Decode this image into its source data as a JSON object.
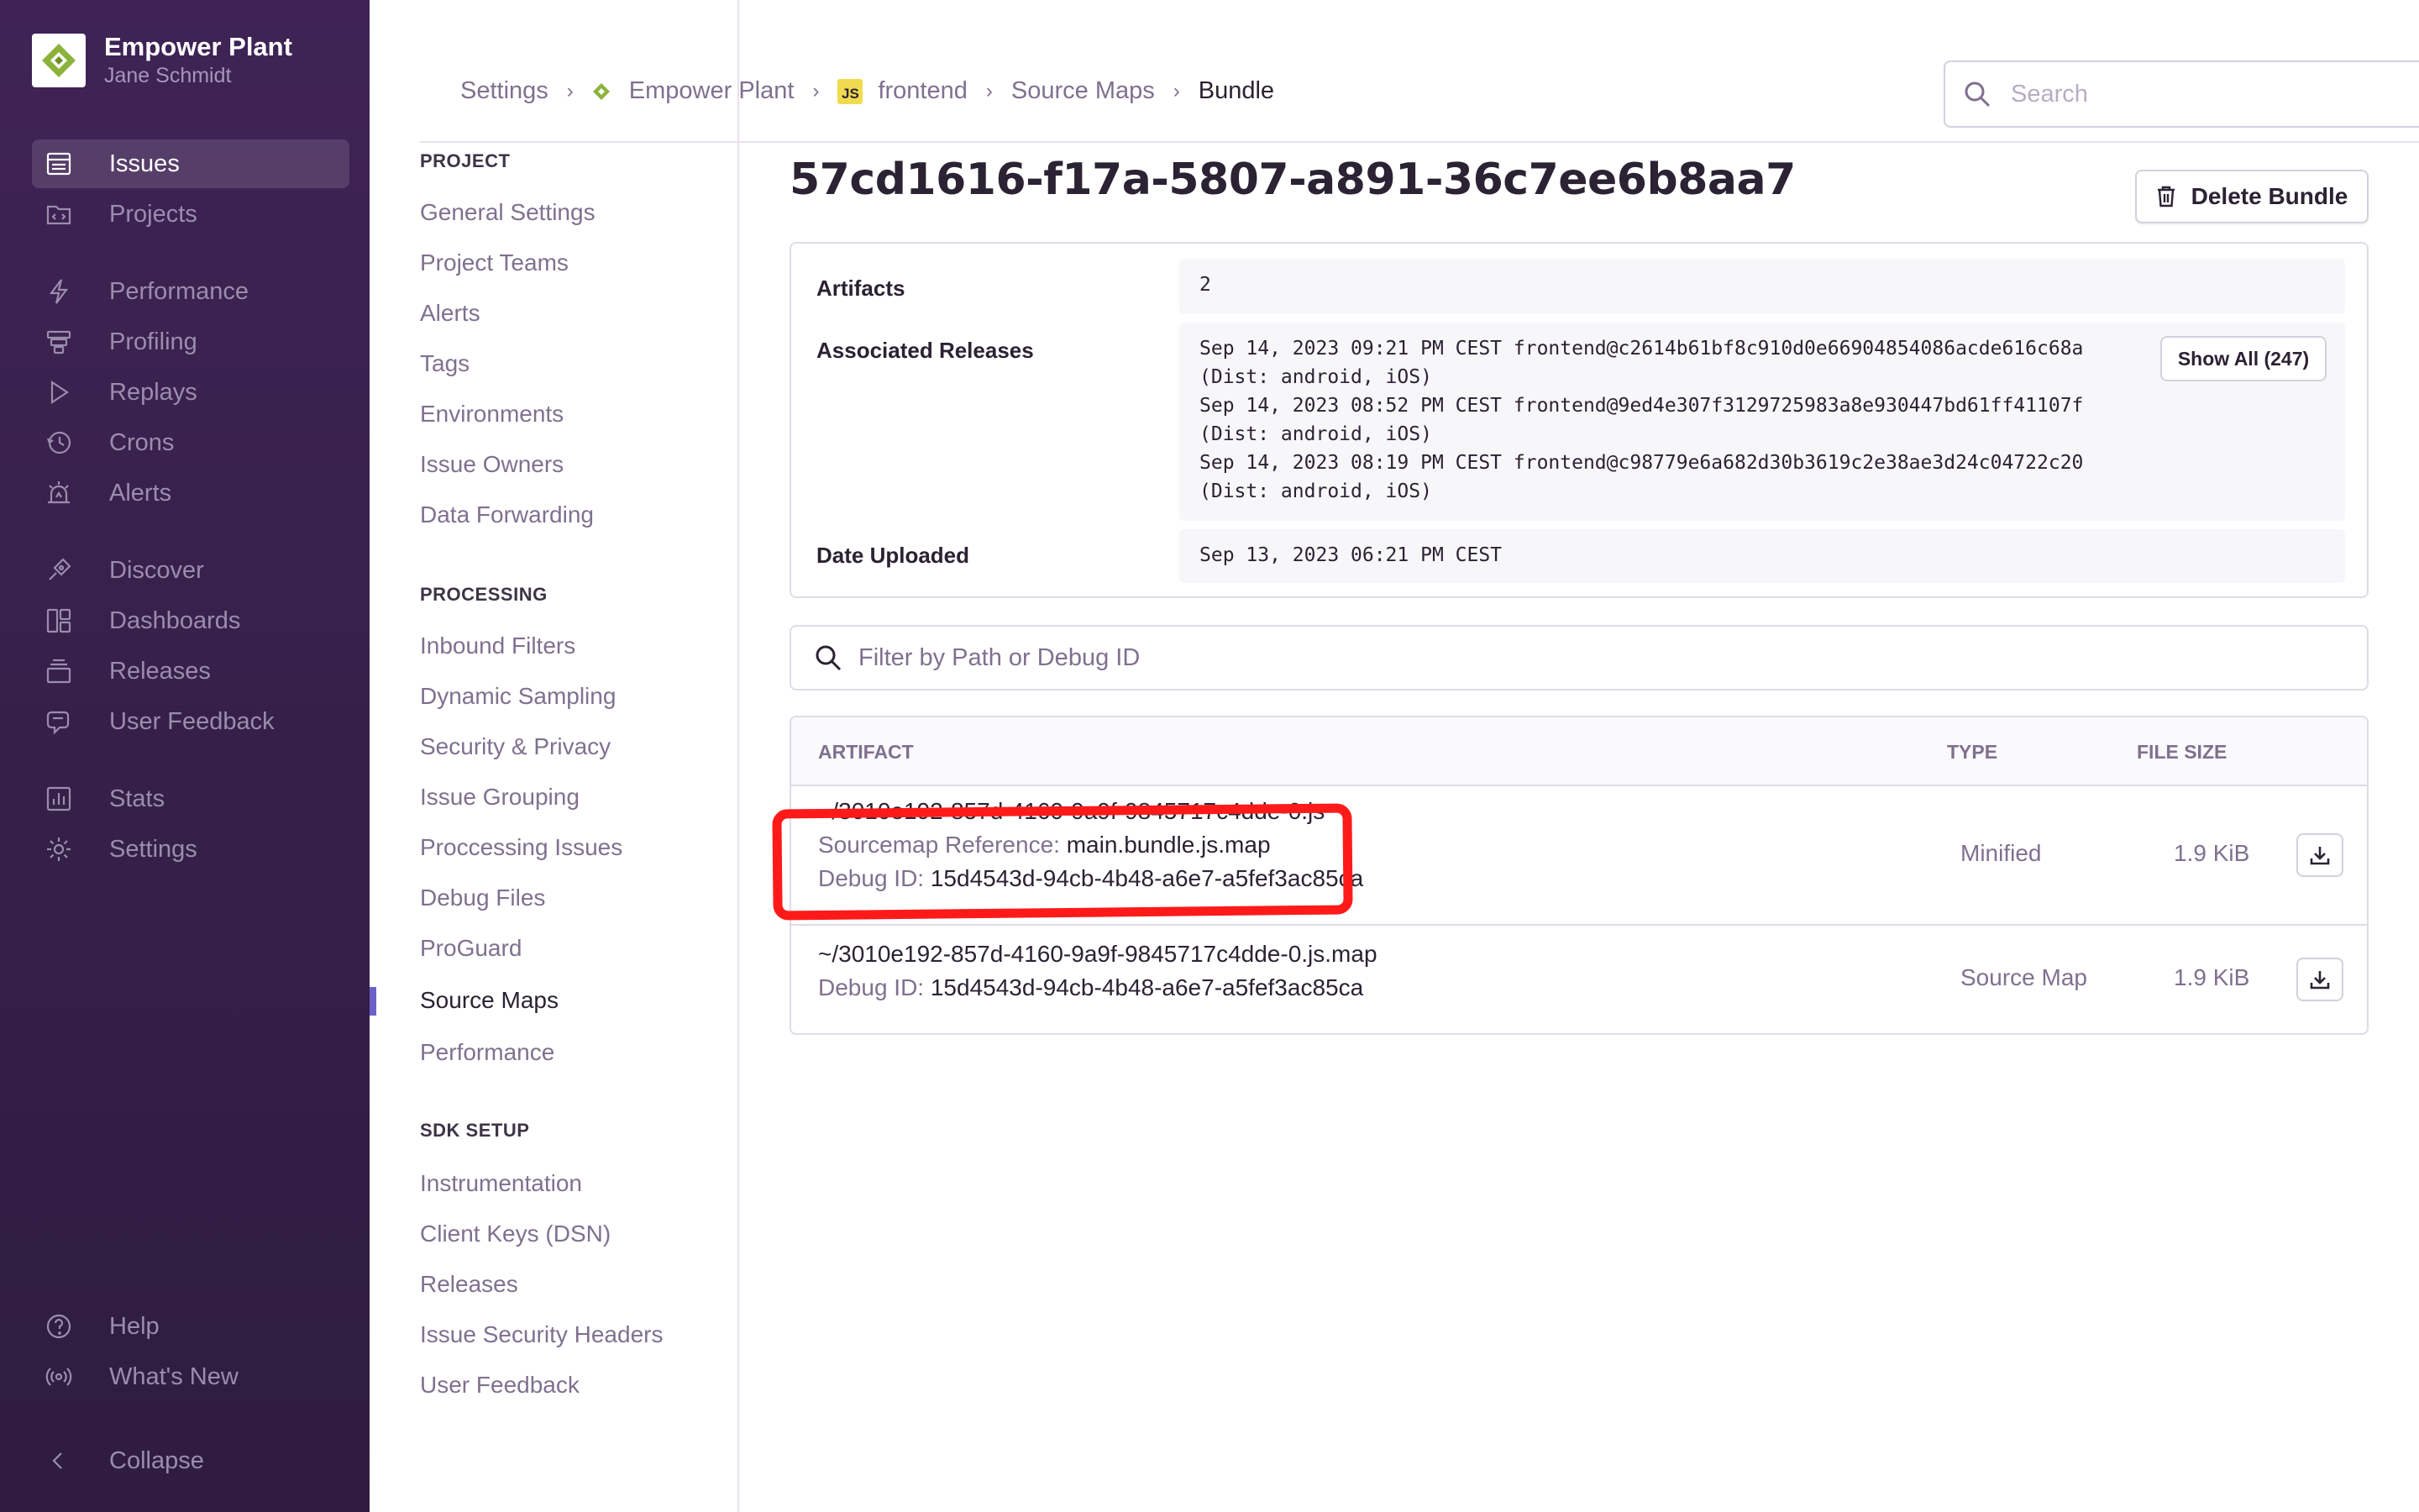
{
  "org": {
    "name": "Empower Plant",
    "user": "Jane Schmidt"
  },
  "sidebar": {
    "items": [
      {
        "label": "Issues",
        "icon": "issues-icon",
        "active": true
      },
      {
        "label": "Projects",
        "icon": "projects-icon"
      },
      {
        "label": "Performance",
        "icon": "performance-icon"
      },
      {
        "label": "Profiling",
        "icon": "profiling-icon"
      },
      {
        "label": "Replays",
        "icon": "replays-icon"
      },
      {
        "label": "Crons",
        "icon": "crons-icon"
      },
      {
        "label": "Alerts",
        "icon": "alerts-icon"
      },
      {
        "label": "Discover",
        "icon": "discover-icon"
      },
      {
        "label": "Dashboards",
        "icon": "dashboards-icon"
      },
      {
        "label": "Releases",
        "icon": "releases-icon"
      },
      {
        "label": "User Feedback",
        "icon": "user-feedback-icon"
      },
      {
        "label": "Stats",
        "icon": "stats-icon"
      },
      {
        "label": "Settings",
        "icon": "settings-icon"
      }
    ],
    "footer": [
      {
        "label": "Help",
        "icon": "help-icon"
      },
      {
        "label": "What's New",
        "icon": "broadcast-icon"
      },
      {
        "label": "Collapse",
        "icon": "chevron-left-icon"
      }
    ]
  },
  "breadcrumb": [
    "Settings",
    "Empower Plant",
    "frontend",
    "Source Maps",
    "Bundle"
  ],
  "js_badge": "JS",
  "search": {
    "placeholder": "Search"
  },
  "settings_nav": {
    "project_title": "PROJECT",
    "project": [
      "General Settings",
      "Project Teams",
      "Alerts",
      "Tags",
      "Environments",
      "Issue Owners",
      "Data Forwarding"
    ],
    "processing_title": "PROCESSING",
    "processing": [
      "Inbound Filters",
      "Dynamic Sampling",
      "Security & Privacy",
      "Issue Grouping",
      "Proccessing Issues",
      "Debug Files",
      "ProGuard",
      "Source Maps",
      "Performance"
    ],
    "sdk_title": "SDK SETUP",
    "sdk": [
      "Instrumentation",
      "Client Keys (DSN)",
      "Releases",
      "Issue Security Headers",
      "User Feedback"
    ],
    "active": "Source Maps"
  },
  "bundle": {
    "title": "57cd1616-f17a-5807-a891-36c7ee6b8aa7",
    "delete_label": "Delete Bundle",
    "artifacts_label": "Artifacts",
    "artifacts_value": "2",
    "releases_label": "Associated Releases",
    "releases": [
      "Sep 14, 2023 09:21 PM CEST frontend@c2614b61bf8c910d0e66904854086acde616c68a",
      "(Dist: android, iOS)",
      "Sep 14, 2023 08:52 PM CEST frontend@9ed4e307f3129725983a8e930447bd61ff41107f",
      "(Dist: android, iOS)",
      "Sep 14, 2023 08:19 PM CEST frontend@c98779e6a682d30b3619c2e38ae3d24c04722c20",
      "(Dist: android, iOS)"
    ],
    "show_all_label": "Show All (247)",
    "uploaded_label": "Date Uploaded",
    "uploaded_value": "Sep 13, 2023 06:21 PM CEST"
  },
  "filter": {
    "placeholder": "Filter by Path or Debug ID"
  },
  "table": {
    "headers": [
      "ARTIFACT",
      "TYPE",
      "FILE SIZE"
    ],
    "rows": [
      {
        "path": "~/3010e192-857d-4160-9a9f-9845717c4dde-0.js",
        "ref_label": "Sourcemap Reference:",
        "ref_value": "main.bundle.js.map",
        "debug_label": "Debug ID:",
        "debug_value": "15d4543d-94cb-4b48-a6e7-a5fef3ac85ca",
        "type": "Minified",
        "size": "1.9 KiB"
      },
      {
        "path": "~/3010e192-857d-4160-9a9f-9845717c4dde-0.js.map",
        "debug_label": "Debug ID:",
        "debug_value": "15d4543d-94cb-4b48-a6e7-a5fef3ac85ca",
        "type": "Source Map",
        "size": "1.9 KiB"
      }
    ]
  },
  "colors": {
    "sidebar": "#3f2356",
    "accent": "#6c5fc7",
    "annotation": "#ff1a1a",
    "js_badge": "#f0db4f"
  }
}
